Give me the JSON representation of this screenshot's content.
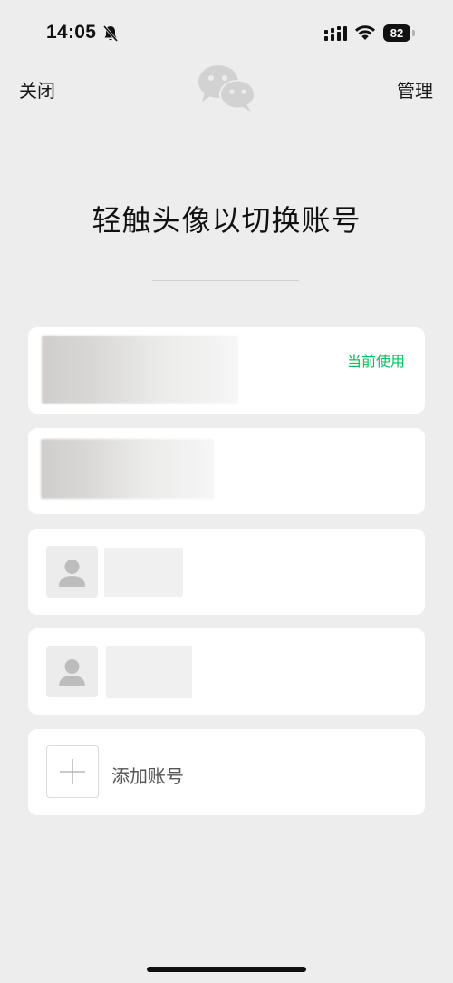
{
  "status_bar": {
    "time": "14:05",
    "battery_level": "82"
  },
  "nav": {
    "close_label": "关闭",
    "manage_label": "管理"
  },
  "title": "轻触头像以切换账号",
  "accounts": [
    {
      "status": "当前使用"
    }
  ],
  "add_account": {
    "label": "添加账号"
  },
  "colors": {
    "background": "#ededed",
    "card": "#ffffff",
    "accent_green": "#07c160"
  },
  "icons": {
    "mute": "bell-slash-icon",
    "signal": "cellular-signal-icon",
    "wifi": "wifi-icon",
    "logo": "wechat-logo-icon",
    "avatar": "default-avatar-icon",
    "add": "plus-icon"
  }
}
